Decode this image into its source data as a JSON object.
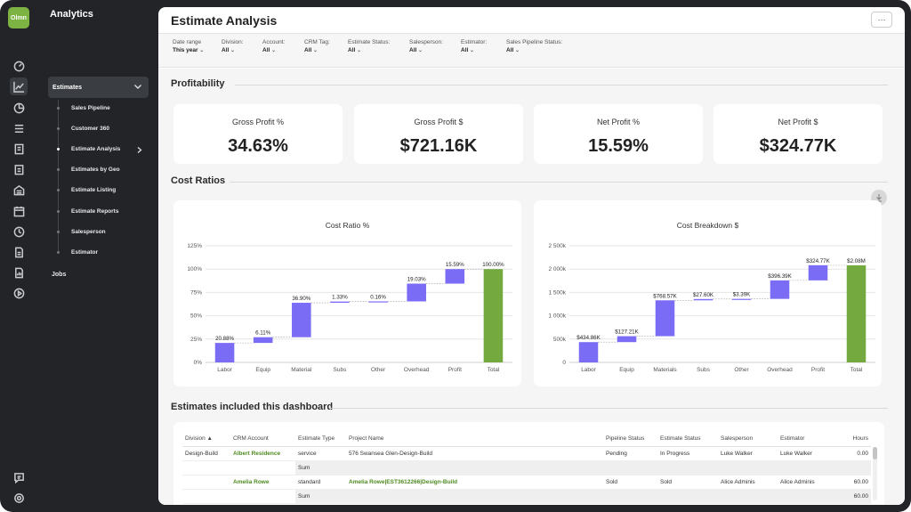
{
  "app": {
    "logo_text": "Olmn",
    "title": "Analytics"
  },
  "rail_icons": [
    "dashboard-icon",
    "chart-line-icon",
    "pie-chart-icon",
    "list-icon",
    "document-icon",
    "clipboard-icon",
    "building-icon",
    "calendar-icon",
    "clock-icon",
    "file-icon",
    "report-icon",
    "play-icon",
    "chat-icon",
    "settings-icon"
  ],
  "sidebar": {
    "section": "Estimates",
    "items": [
      "Sales Pipeline",
      "Customer 360",
      "Estimate Analysis",
      "Estimates by Geo",
      "Estimate Listing",
      "Estimate Reports",
      "Salesperson",
      "Estimator"
    ],
    "current": "Estimate Analysis",
    "jobs": "Jobs"
  },
  "page": {
    "title": "Estimate Analysis",
    "more_label": "···"
  },
  "filters": [
    {
      "label": "Date range",
      "value": "This year"
    },
    {
      "label": "Division:",
      "value": "All"
    },
    {
      "label": "Account:",
      "value": "All"
    },
    {
      "label": "CRM Tag:",
      "value": "All"
    },
    {
      "label": "Estimate Status:",
      "value": "All"
    },
    {
      "label": "Salesperson:",
      "value": "All"
    },
    {
      "label": "Estimator:",
      "value": "All"
    },
    {
      "label": "Sales Pipeline Status:",
      "value": "All"
    }
  ],
  "profitability": {
    "title": "Profitability",
    "kpis": [
      {
        "label": "Gross Profit %",
        "value": "34.63%"
      },
      {
        "label": "Gross Profit $",
        "value": "$721.16K"
      },
      {
        "label": "Net Profit %",
        "value": "15.59%"
      },
      {
        "label": "Net Profit $",
        "value": "$324.77K"
      }
    ]
  },
  "cost_ratios": {
    "title": "Cost Ratios"
  },
  "chart_data": [
    {
      "type": "bar",
      "subtype": "waterfall",
      "title": "Cost Ratio %",
      "categories": [
        "Labor",
        "Equip",
        "Material",
        "Subs",
        "Other",
        "Overhead",
        "Profit",
        "Total"
      ],
      "values": [
        20.88,
        6.11,
        36.9,
        1.33,
        0.16,
        19.03,
        15.59,
        100.0
      ],
      "data_labels": [
        "20.88%",
        "6.11%",
        "36.90%",
        "1.33%",
        "0.16%",
        "19.03%",
        "15.59%",
        "100.00%"
      ],
      "yticks": [
        "0%",
        "25%",
        "50%",
        "75%",
        "100%",
        "125%"
      ],
      "ylim": [
        0,
        125
      ],
      "colors": {
        "step": "#7b6cf6",
        "total": "#74a93f"
      },
      "grid": true
    },
    {
      "type": "bar",
      "subtype": "waterfall",
      "title": "Cost Breakdown $",
      "categories": [
        "Labor",
        "Equip",
        "Materials",
        "Subs",
        "Other",
        "Overhead",
        "Profit",
        "Total"
      ],
      "values": [
        434860,
        127210,
        768570,
        27600,
        3390,
        396390,
        324770,
        2080000
      ],
      "data_labels": [
        "$434.86K",
        "$127.21K",
        "$768.57K",
        "$27.60K",
        "$3.39K",
        "$396.39K",
        "$324.77K",
        "$2.08M"
      ],
      "yticks": [
        "0",
        "500k",
        "1 000k",
        "1 500k",
        "2 000k",
        "2 500k"
      ],
      "ylim": [
        0,
        2500000
      ],
      "colors": {
        "step": "#7b6cf6",
        "total": "#74a93f"
      },
      "grid": true
    }
  ],
  "estimates_table": {
    "title": "Estimates included this dashboard",
    "columns": [
      "Division ▲",
      "CRM Account",
      "Estimate Type",
      "Project Name",
      "Pipeline Status",
      "Estimate Status",
      "Salesperson",
      "Estimator",
      "Hours"
    ],
    "rows": [
      {
        "division": "Design-Build",
        "account": "Albert Residence",
        "type": "service",
        "project": "576 Swansea Glen-Design-Build",
        "pipeline": "Pending",
        "status": "In Progress",
        "salesperson": "Luke Walker",
        "estimator": "Luke Walker",
        "hours": "0.00"
      },
      {
        "division": "",
        "account": "Amelia Rowe",
        "type": "standard",
        "project": "Amelia Rowe|EST3612266|Design-Build",
        "pipeline": "Sold",
        "status": "Sold",
        "salesperson": "Alice Adminis",
        "estimator": "Alice Adminis",
        "hours": "60.00"
      }
    ],
    "sum_label": "Sum",
    "sums": [
      "",
      "60.00"
    ]
  },
  "download_icon": "download-icon"
}
